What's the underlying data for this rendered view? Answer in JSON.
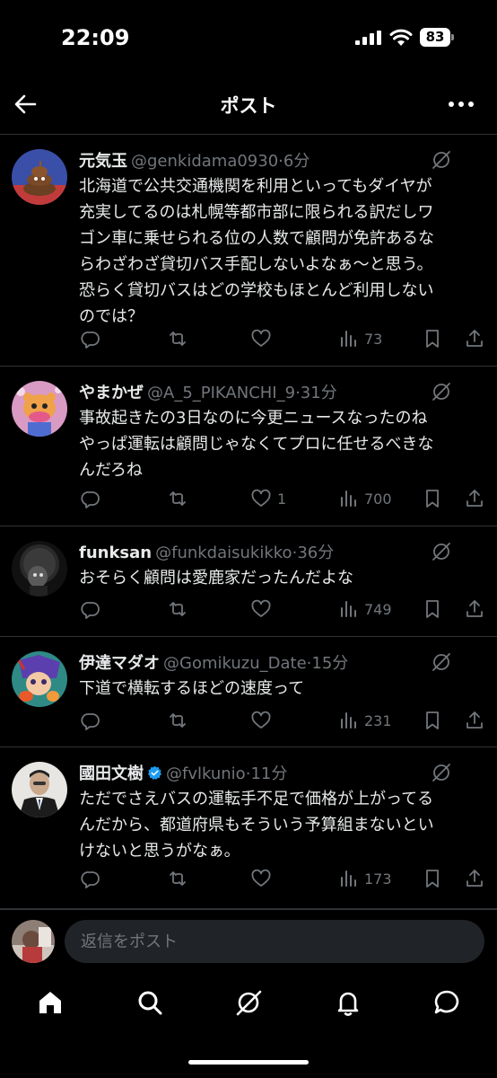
{
  "status_bar": {
    "time": "22:09",
    "battery": "83"
  },
  "header": {
    "title": "ポスト",
    "back_icon": "arrow-left-icon",
    "more_icon": "more-horizontal-icon"
  },
  "replies": [
    {
      "name": "元気玉",
      "verified": false,
      "handle": "@genkidama0930",
      "dot": "·",
      "time": "6分",
      "lines": [
        "北海道で公共交通機関を利用といってもダイヤが",
        "充実してるのは札幌等都市部に限られる訳だしワ",
        "ゴン車に乗せられる位の人数で顧問が免許あるな",
        "らわざわざ貸切バス手配しないよなぁ〜と思う。",
        "恐らく貸切バスはどの学校もほとんど利用しない",
        "のでは？"
      ],
      "likes": "",
      "views": "73"
    },
    {
      "name": "やまかぜ",
      "verified": false,
      "handle": "@A_5_PIKANCHI_9",
      "dot": "·",
      "time": "31分",
      "lines": [
        "事故起きたの3日なのに今更ニュースなったのね",
        "やっぱ運転は顧問じゃなくてプロに任せるべきな",
        "んだろね"
      ],
      "likes": "1",
      "views": "700"
    },
    {
      "name": "funksan",
      "verified": false,
      "handle": "@funkdaisukikko",
      "dot": "·",
      "time": "36分",
      "lines": [
        "おそらく顧問は愛鹿家だったんだよな"
      ],
      "likes": "",
      "views": "749"
    },
    {
      "name": "伊達マダオ",
      "verified": false,
      "handle": "@Gomikuzu_Date",
      "dot": "·",
      "time": "15分",
      "lines": [
        "下道で横転するほどの速度って"
      ],
      "likes": "",
      "views": "231"
    },
    {
      "name": "國田文樹",
      "verified": true,
      "handle": "@fvlkunio",
      "dot": "·",
      "time": "11分",
      "lines": [
        "ただでさえバスの運転手不足で価格が上がってる",
        "んだから、都道府県もそういう予算組まないとい",
        "けないと思うがなぁ。"
      ],
      "likes": "",
      "views": "173"
    }
  ],
  "compose": {
    "placeholder": "返信をポスト"
  },
  "tabs": [
    "home-icon",
    "search-icon",
    "grok-icon",
    "notifications-icon",
    "messages-icon"
  ],
  "colors": {
    "background": "#000000",
    "text": "#e7e9ea",
    "muted": "#71767b",
    "verified": "#1d9bf0",
    "divider": "#2f3336"
  }
}
